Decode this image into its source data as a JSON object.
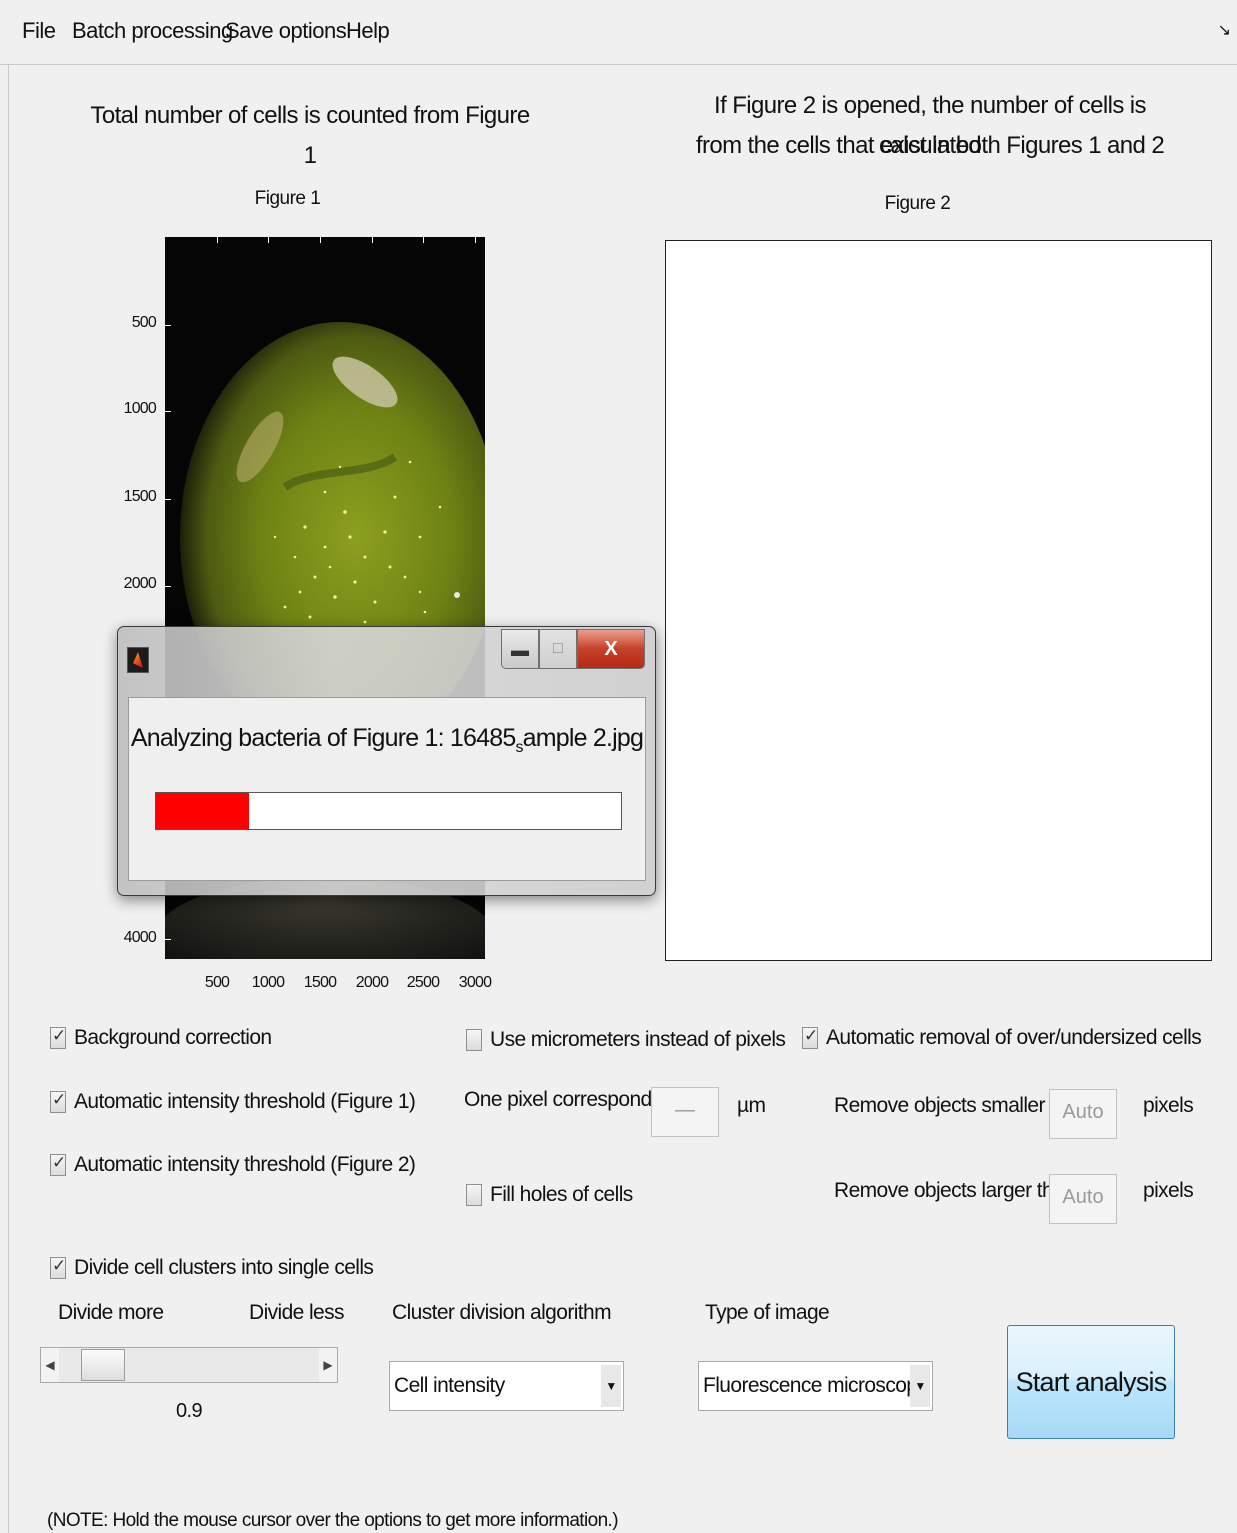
{
  "menu": [
    "File",
    "Batch processing",
    "Save options",
    "Help"
  ],
  "undock_icon": "undock-arrow-icon",
  "headings": {
    "left": "Total number of cells is counted from Figure 1",
    "right_line1": "If Figure 2 is opened, the number of cells is calculated",
    "right_line2": "from the cells that exist in both Figures 1 and 2"
  },
  "figure1": {
    "title": "Figure 1",
    "yticks": [
      "500",
      "1000",
      "1500",
      "2000",
      "4000"
    ],
    "xticks": [
      "500",
      "1000",
      "1500",
      "2000",
      "2500",
      "3000"
    ]
  },
  "figure2": {
    "title": "Figure 2"
  },
  "options": {
    "background_correction": {
      "label": "Background correction",
      "checked": true
    },
    "auto_threshold_fig1": {
      "label": "Automatic intensity threshold (Figure 1)",
      "checked": true
    },
    "auto_threshold_fig2": {
      "label": "Automatic intensity threshold (Figure 2)",
      "checked": true
    },
    "use_micrometers": {
      "label": "Use micrometers instead of pixels",
      "checked": false
    },
    "pixel_corresponds_label": "One pixel corresponds to",
    "pixel_value": "—",
    "unit_um": "µm",
    "fill_holes": {
      "label": "Fill holes of cells",
      "checked": false
    },
    "auto_removal": {
      "label": "Automatic removal of over/undersized cells",
      "checked": true
    },
    "remove_smaller_label": "Remove objects smaller than",
    "remove_smaller_value": "Auto",
    "remove_larger_label": "Remove objects larger than",
    "remove_larger_value": "Auto",
    "pixels_unit": "pixels",
    "divide_clusters": {
      "label": "Divide cell clusters into single cells",
      "checked": true
    },
    "divide_more": "Divide more",
    "divide_less": "Divide less",
    "slider_value": "0.9",
    "slider_fraction": 0.1
  },
  "cluster_algorithm": {
    "label": "Cluster division algorithm",
    "selected": "Cell intensity"
  },
  "image_type": {
    "label": "Type of image",
    "selected": "Fluorescence microscopy"
  },
  "start_button": "Start analysis",
  "note": "(NOTE: Hold the mouse cursor over the options to get more information.)",
  "dialog": {
    "close_label": "X",
    "message_main": "Analyzing bacteria of Figure 1: 16485",
    "message_sub": "s",
    "message_tail": "ample 2.jpg",
    "progress": 0.2
  }
}
